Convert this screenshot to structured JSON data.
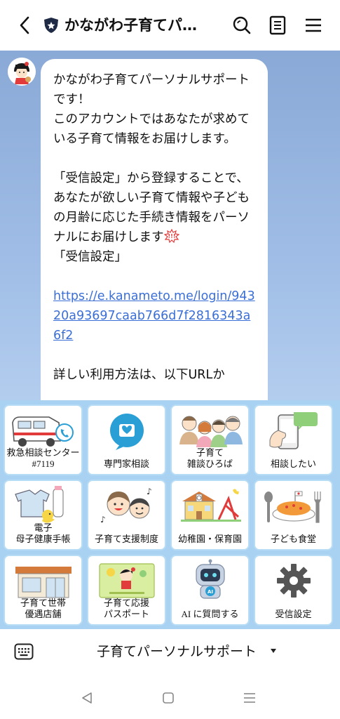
{
  "header": {
    "title": "かながわ子育てパ…",
    "icons": [
      "back-arrow-icon",
      "shield-icon",
      "search-icon",
      "notes-icon",
      "menu-icon"
    ]
  },
  "message": {
    "paragraph1": "かながわ子育てパーソナルサポートです！\nこのアカウントではあなたが求めている子育て情報をお届けします。",
    "paragraph2": "「受信設定」から登録することで、あなたが欲しい子育て情報や子どもの月齢に応じた手続き情報をパーソナルにお届けします",
    "paragraph2_tail": "「受信設定」",
    "link": "https://e.kanameto.me/login/94320a93697caab766d7f2816343a6f2",
    "cut_off": "詳しい利用方法は、以下URLか"
  },
  "rich_menu": {
    "items": [
      {
        "label": "救急相談センター\n#7119",
        "icon": "ambulance-icon"
      },
      {
        "label": "専門家相談",
        "icon": "heart-chat-icon"
      },
      {
        "label": "子育て\n雑談ひろば",
        "icon": "family-group-icon"
      },
      {
        "label": "相談したい",
        "icon": "phone-chat-icon"
      },
      {
        "label": "電子\n母子健康手帳",
        "icon": "baby-items-icon"
      },
      {
        "label": "子育て支援制度",
        "icon": "children-icon"
      },
      {
        "label": "幼稚園・保育園",
        "icon": "kindergarten-icon"
      },
      {
        "label": "子ども食堂",
        "icon": "omurice-icon"
      },
      {
        "label": "子育て世帯\n優遇店舗",
        "icon": "shop-icon"
      },
      {
        "label": "子育て応援\nパスポート",
        "icon": "passport-card-icon"
      },
      {
        "label": "AI に質問する",
        "icon": "robot-icon"
      },
      {
        "label": "受信設定",
        "icon": "gear-icon"
      }
    ]
  },
  "bottom_bar": {
    "menu_name": "子育てパーソナルサポート"
  },
  "colors": {
    "chat_bg": "#9fbde6",
    "menu_bg": "#a9d2f2",
    "link": "#3b6fd6",
    "cell_border": "#b7dcf5",
    "accent_teal": "#2a9fd6"
  }
}
